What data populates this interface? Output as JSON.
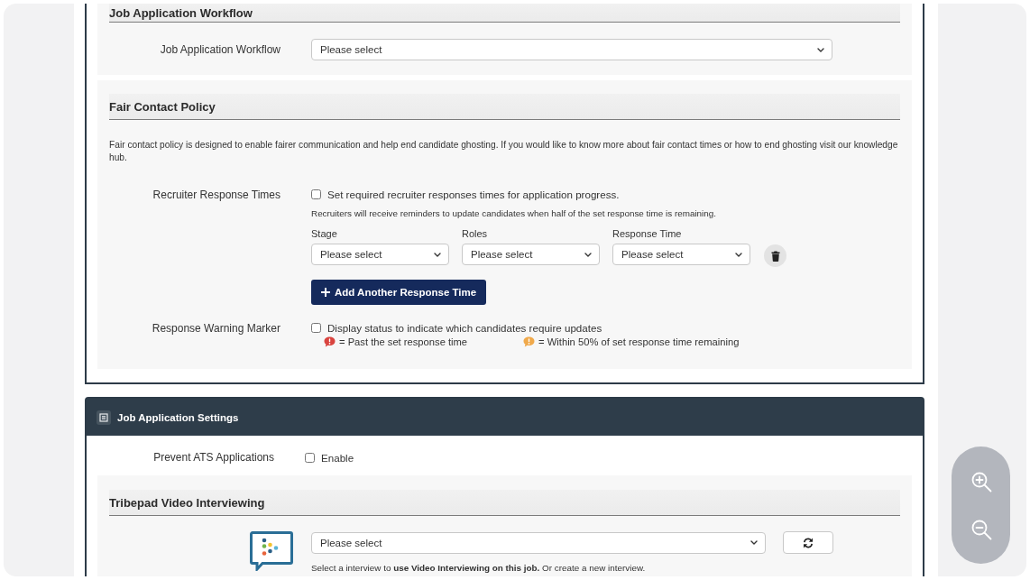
{
  "workflow": {
    "title": "Job Application Workflow",
    "field": {
      "label": "Job Application Workflow",
      "value": "Please select"
    }
  },
  "fair_contact_policy": {
    "title": "Fair Contact Policy",
    "description": "Fair contact policy is designed to enable fairer communication and help end candidate ghosting. If you would like to know more about fair contact times or how to end ghosting visit our knowledge hub.",
    "response_times": {
      "label": "Recruiter Response Times",
      "option": {
        "label": "Set required recruiter responses times for application progress.",
        "checked": false
      },
      "hint": "Recruiters will receive reminders to update candidates when half of the set response time is remaining.",
      "selects": [
        {
          "label": "Stage",
          "value": "Please select"
        },
        {
          "label": "Roles",
          "value": "Please select"
        },
        {
          "label": "Response Time",
          "value": "Please select"
        }
      ],
      "add_button": "Add Another Response Time"
    },
    "warning_marker": {
      "label": "Response Warning Marker",
      "option": {
        "label": "Display status to indicate which candidates require updates",
        "checked": false
      },
      "legend": [
        {
          "text": "= Past the set response time",
          "color": "#d9443f"
        },
        {
          "text": "= Within 50% of set response time remaining",
          "color": "#f0a94b"
        }
      ]
    }
  },
  "job_application_settings": {
    "title": "Job Application Settings",
    "prevent_ats": {
      "label": "Prevent ATS Applications",
      "option": {
        "label": "Enable",
        "checked": false
      }
    },
    "video_interviewing": {
      "title": "Tribepad Video Interviewing",
      "select": {
        "value": "Please select"
      },
      "hint": "Select a interview to **use Video Interviewing on this job.** Or create a new interview."
    }
  }
}
